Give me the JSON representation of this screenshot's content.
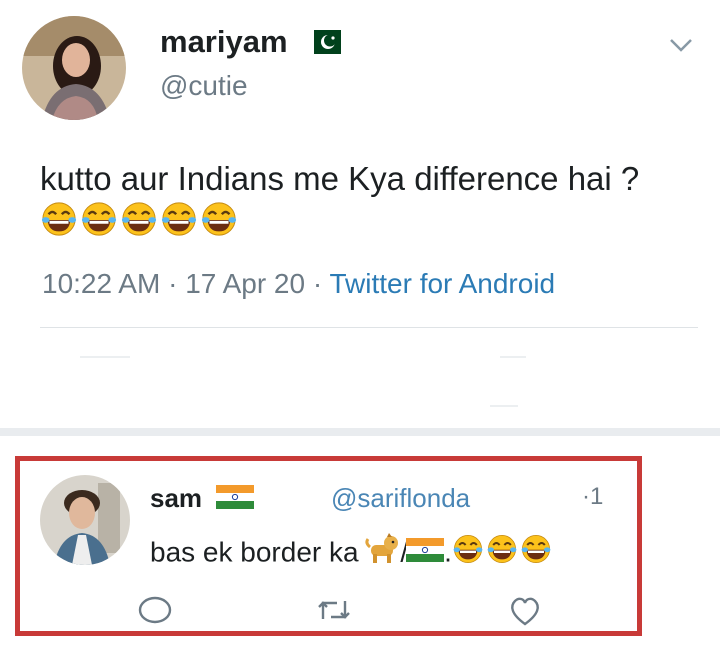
{
  "tweet": {
    "author_name": "mariyam",
    "author_flag_icon": "pakistan-flag-icon",
    "author_handle": "@cutie",
    "text": "kutto aur Indians me Kya difference hai ?",
    "text_emojis": [
      "face-with-tears-of-joy-icon",
      "face-with-tears-of-joy-icon",
      "face-with-tears-of-joy-icon",
      "face-with-tears-of-joy-icon",
      "face-with-tears-of-joy-icon"
    ],
    "time": "10:22 AM",
    "sep": "·",
    "date": "17 Apr 20",
    "source": "Twitter for Android"
  },
  "reply": {
    "author_name": "sam",
    "author_flag_icon": "india-flag-icon",
    "author_handle": "@sariflonda",
    "reply_count_prefix": "·",
    "reply_count": "1",
    "text": "bas ek border ka",
    "slash": "/",
    "period": ".",
    "text_icons": [
      "dog-icon",
      "india-flag-icon",
      "face-with-tears-of-joy-icon",
      "face-with-tears-of-joy-icon",
      "face-with-tears-of-joy-icon"
    ],
    "actions": [
      "reply-icon",
      "retweet-icon",
      "like-icon"
    ]
  },
  "colors": {
    "highlight_border": "#c83a38",
    "secondary_text": "#6c7a85",
    "link": "#2b7bb5"
  }
}
